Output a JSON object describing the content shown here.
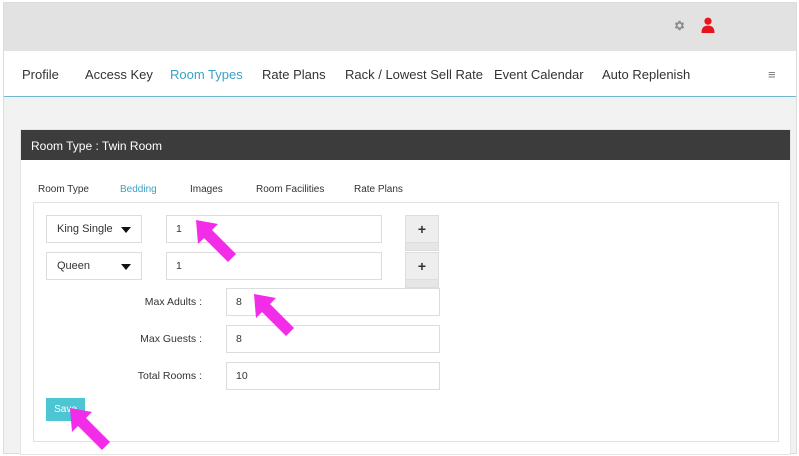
{
  "nav": {
    "items": [
      {
        "label": "Profile"
      },
      {
        "label": "Access Key"
      },
      {
        "label": "Room Types"
      },
      {
        "label": "Rate Plans"
      },
      {
        "label": "Rack / Lowest Sell Rate"
      },
      {
        "label": "Event Calendar"
      },
      {
        "label": "Auto Replenish"
      }
    ],
    "active_index": 2,
    "menu_glyph": "≡"
  },
  "topbar": {
    "icons": [
      "gear-icon",
      "user-icon"
    ],
    "user_icon_color": "#e8141b"
  },
  "panel": {
    "title": "Room Type : Twin Room",
    "tabs": [
      {
        "label": "Room Type"
      },
      {
        "label": "Bedding"
      },
      {
        "label": "Images"
      },
      {
        "label": "Room Facilities"
      },
      {
        "label": "Rate Plans"
      }
    ],
    "active_tab": 1
  },
  "bedding": [
    {
      "bed_type": "King Single",
      "quantity": "1",
      "add_label": "+"
    },
    {
      "bed_type": "Queen",
      "quantity": "1",
      "add_label": "+"
    }
  ],
  "fields": {
    "max_adults": {
      "label": "Max Adults :",
      "value": "8"
    },
    "max_guests": {
      "label": "Max Guests :",
      "value": "8"
    },
    "total_rooms": {
      "label": "Total Rooms :",
      "value": "10"
    }
  },
  "save_label": "Save",
  "colors": {
    "accent": "#3aa2c8",
    "save_button": "#4cc6d3",
    "panel_header": "#3c3c3c",
    "annotation_arrow": "#f22ce8"
  }
}
